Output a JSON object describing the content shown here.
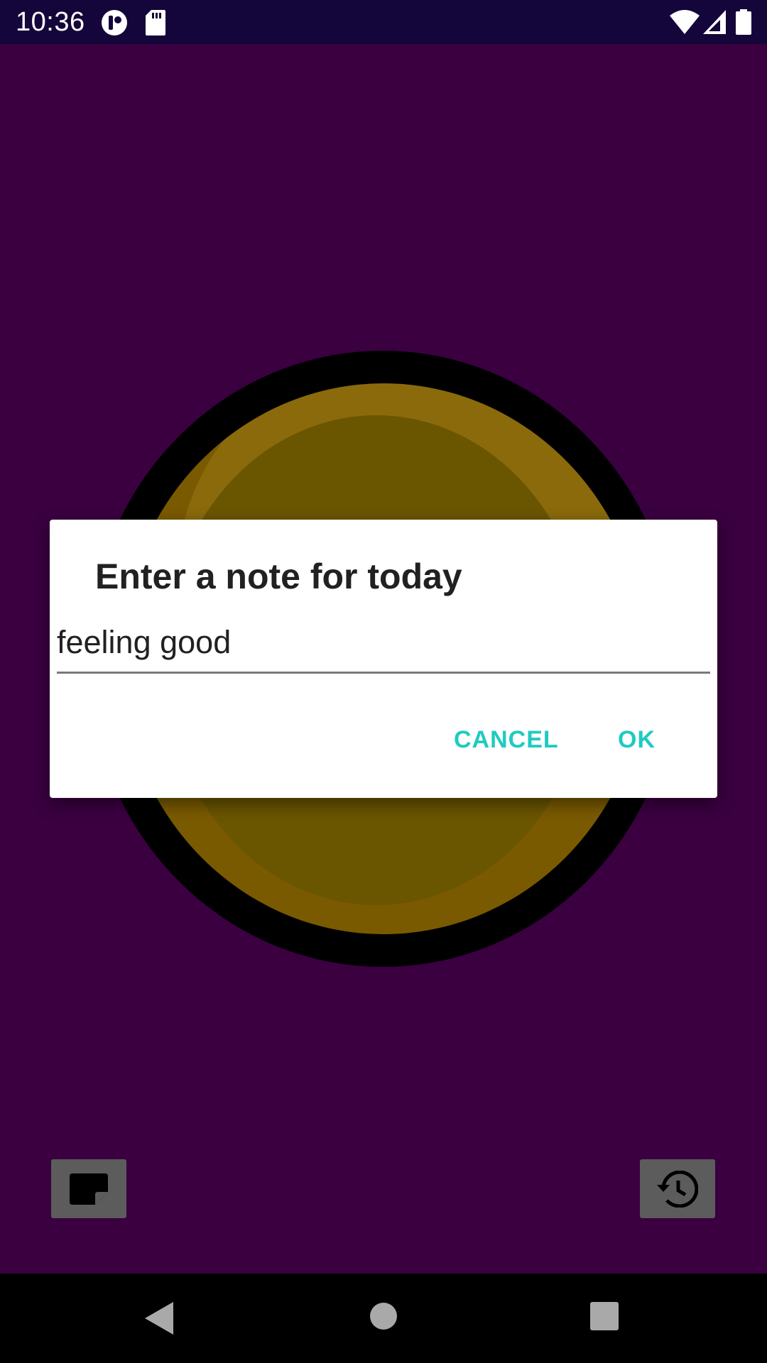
{
  "status_bar": {
    "time": "10:36",
    "icons": [
      "app-notification-icon",
      "sd-card-icon",
      "wifi-icon",
      "signal-icon",
      "battery-icon"
    ]
  },
  "dialog": {
    "title": "Enter a note for today",
    "input_value": "feeling good",
    "cancel_label": "CANCEL",
    "ok_label": "OK",
    "button_color": "#1fcbc2"
  },
  "app": {
    "background_color": "#3a0040",
    "mood_color": "#7a5a00",
    "actions": [
      "note-icon",
      "history-icon"
    ]
  },
  "nav_bar": {
    "icons": [
      "back-icon",
      "home-icon",
      "recents-icon"
    ]
  }
}
